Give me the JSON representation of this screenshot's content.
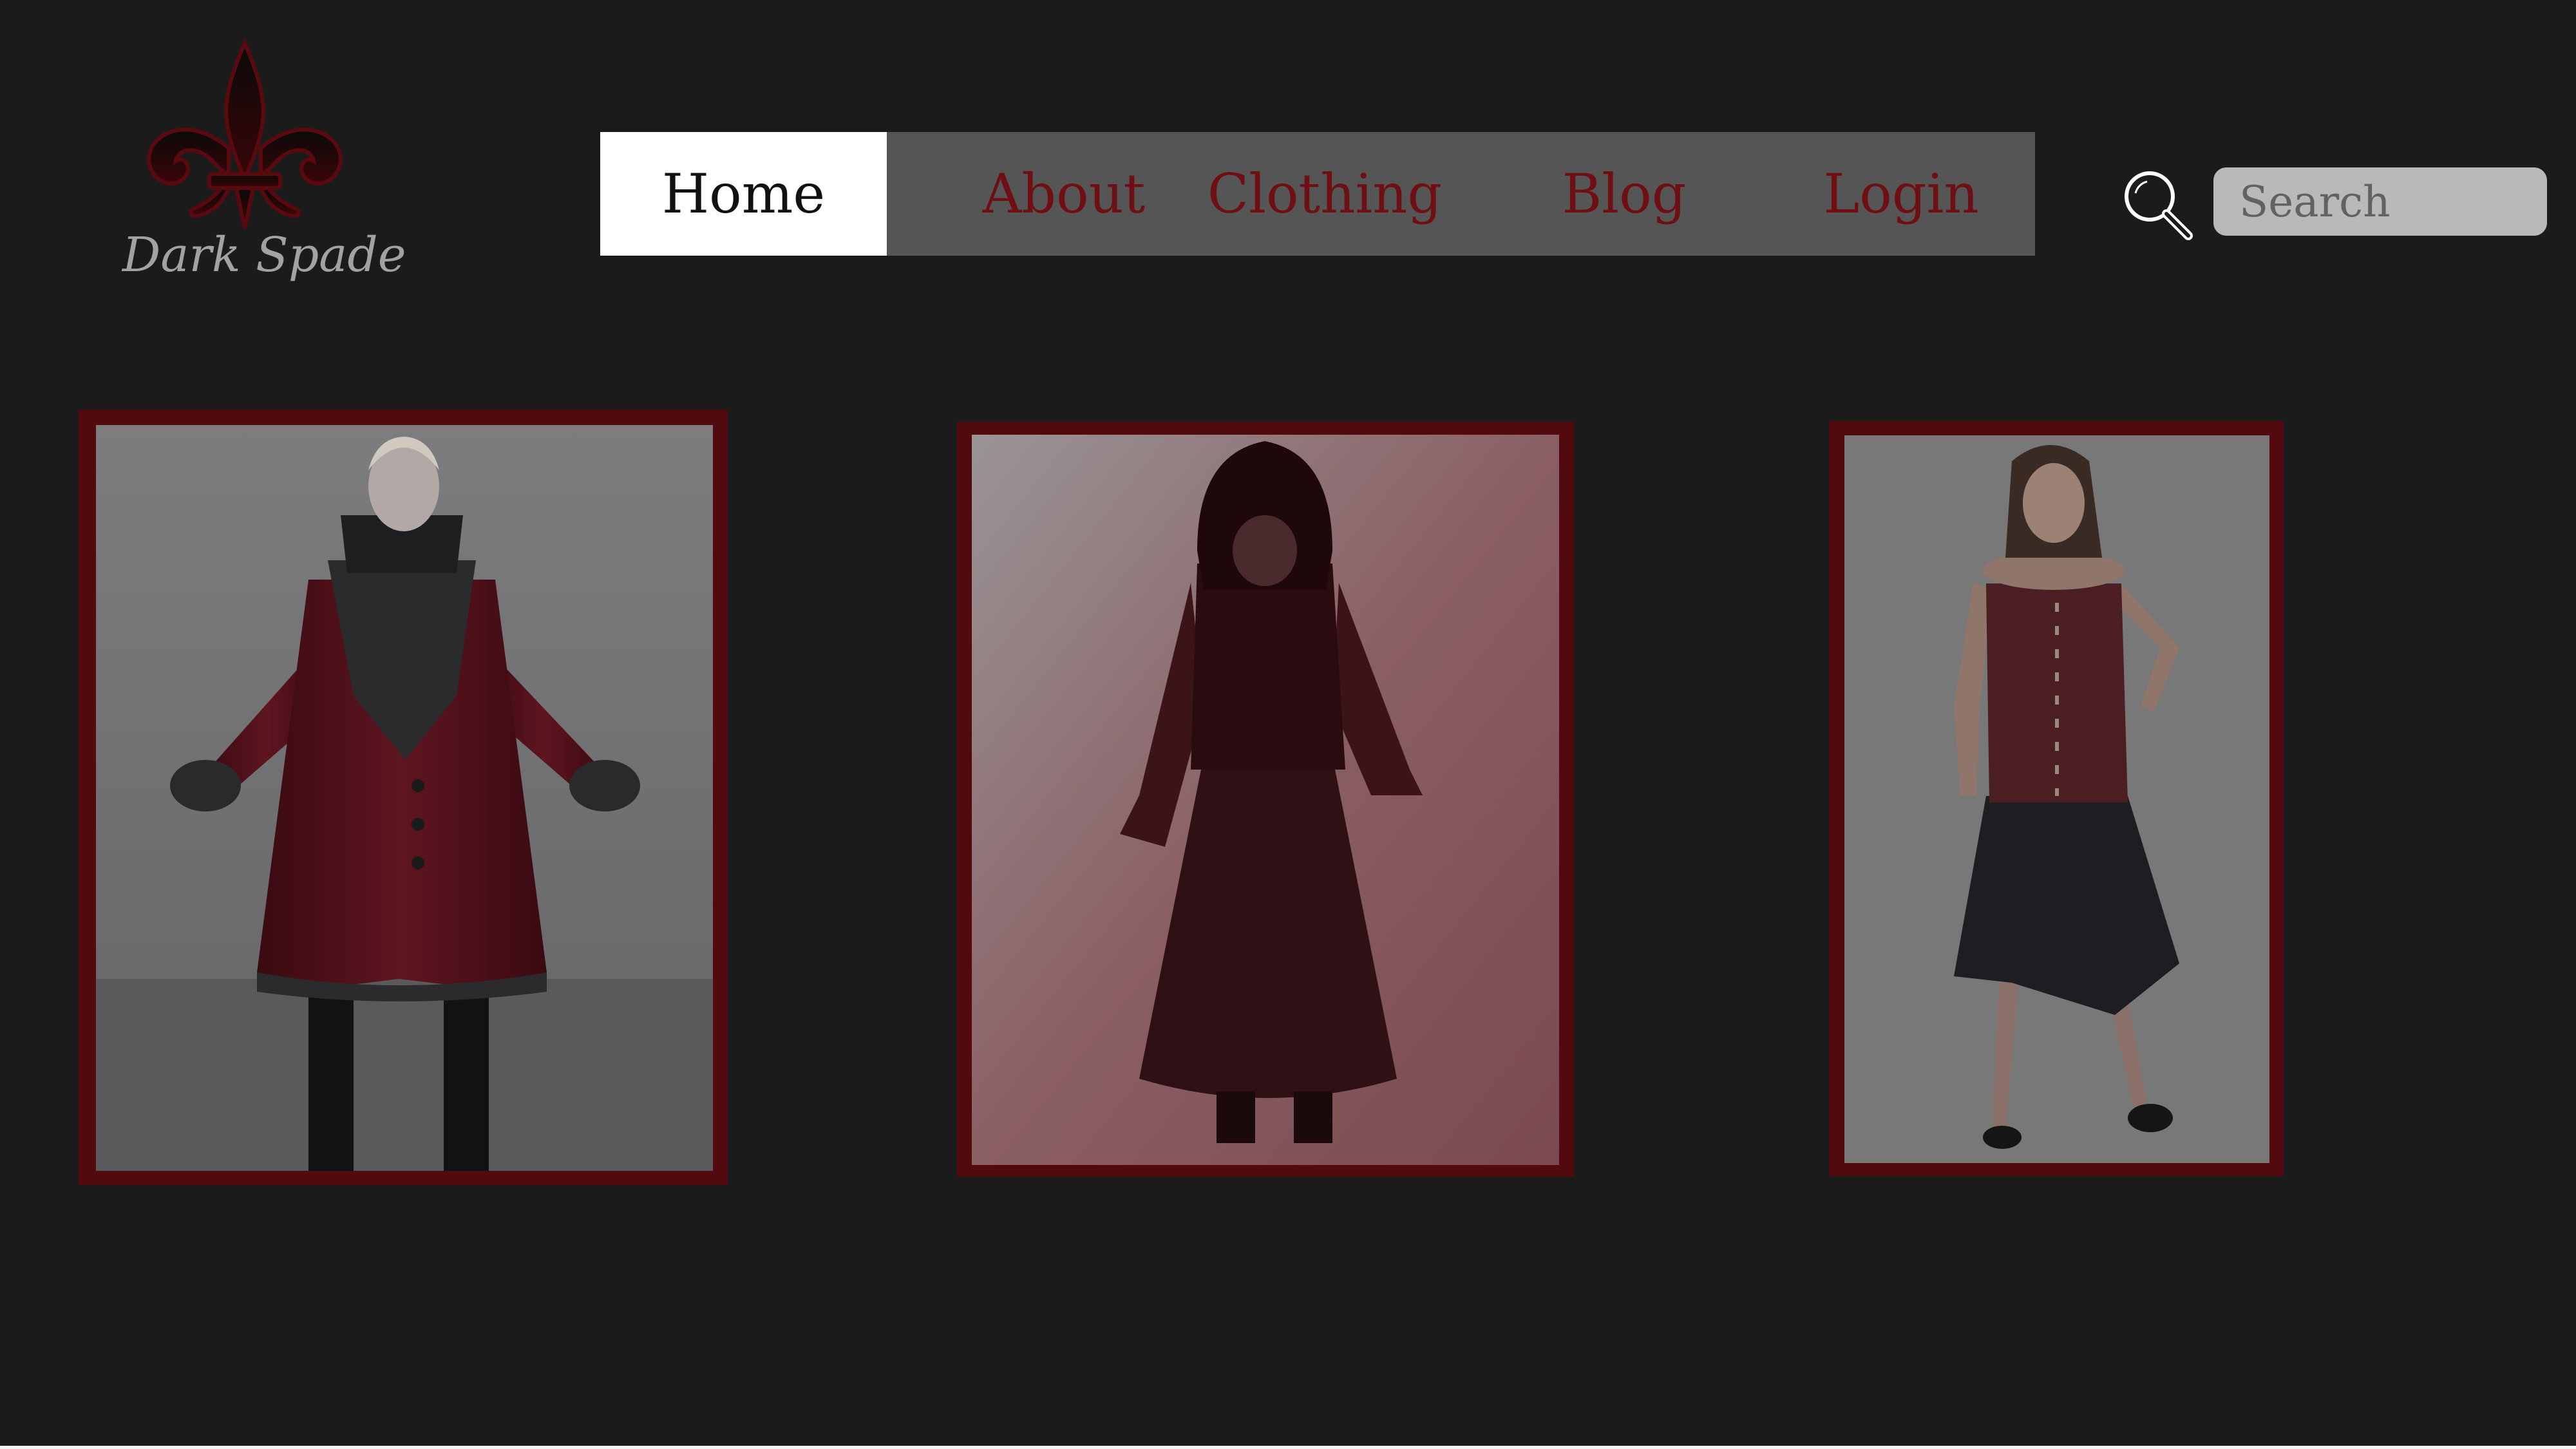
{
  "brand": {
    "name": "Dark Spade",
    "logo_icon": "fleur-de-lis-icon",
    "colors": {
      "background": "#1b1b1b",
      "accent": "#6e0f14",
      "frame": "#520a0e",
      "nav_bg": "#555555"
    }
  },
  "nav": {
    "items": [
      {
        "label": "Home",
        "active": true
      },
      {
        "label": "About",
        "active": false
      },
      {
        "label": "Clothing",
        "active": false
      },
      {
        "label": "Blog",
        "active": false
      },
      {
        "label": "Login",
        "active": false
      }
    ]
  },
  "search": {
    "placeholder": "Search",
    "icon": "magnifier-icon"
  },
  "products": [
    {
      "image": "red-velvet-gothic-coat"
    },
    {
      "image": "black-lace-hooded-gown"
    },
    {
      "image": "corset-ruffle-dress"
    }
  ]
}
